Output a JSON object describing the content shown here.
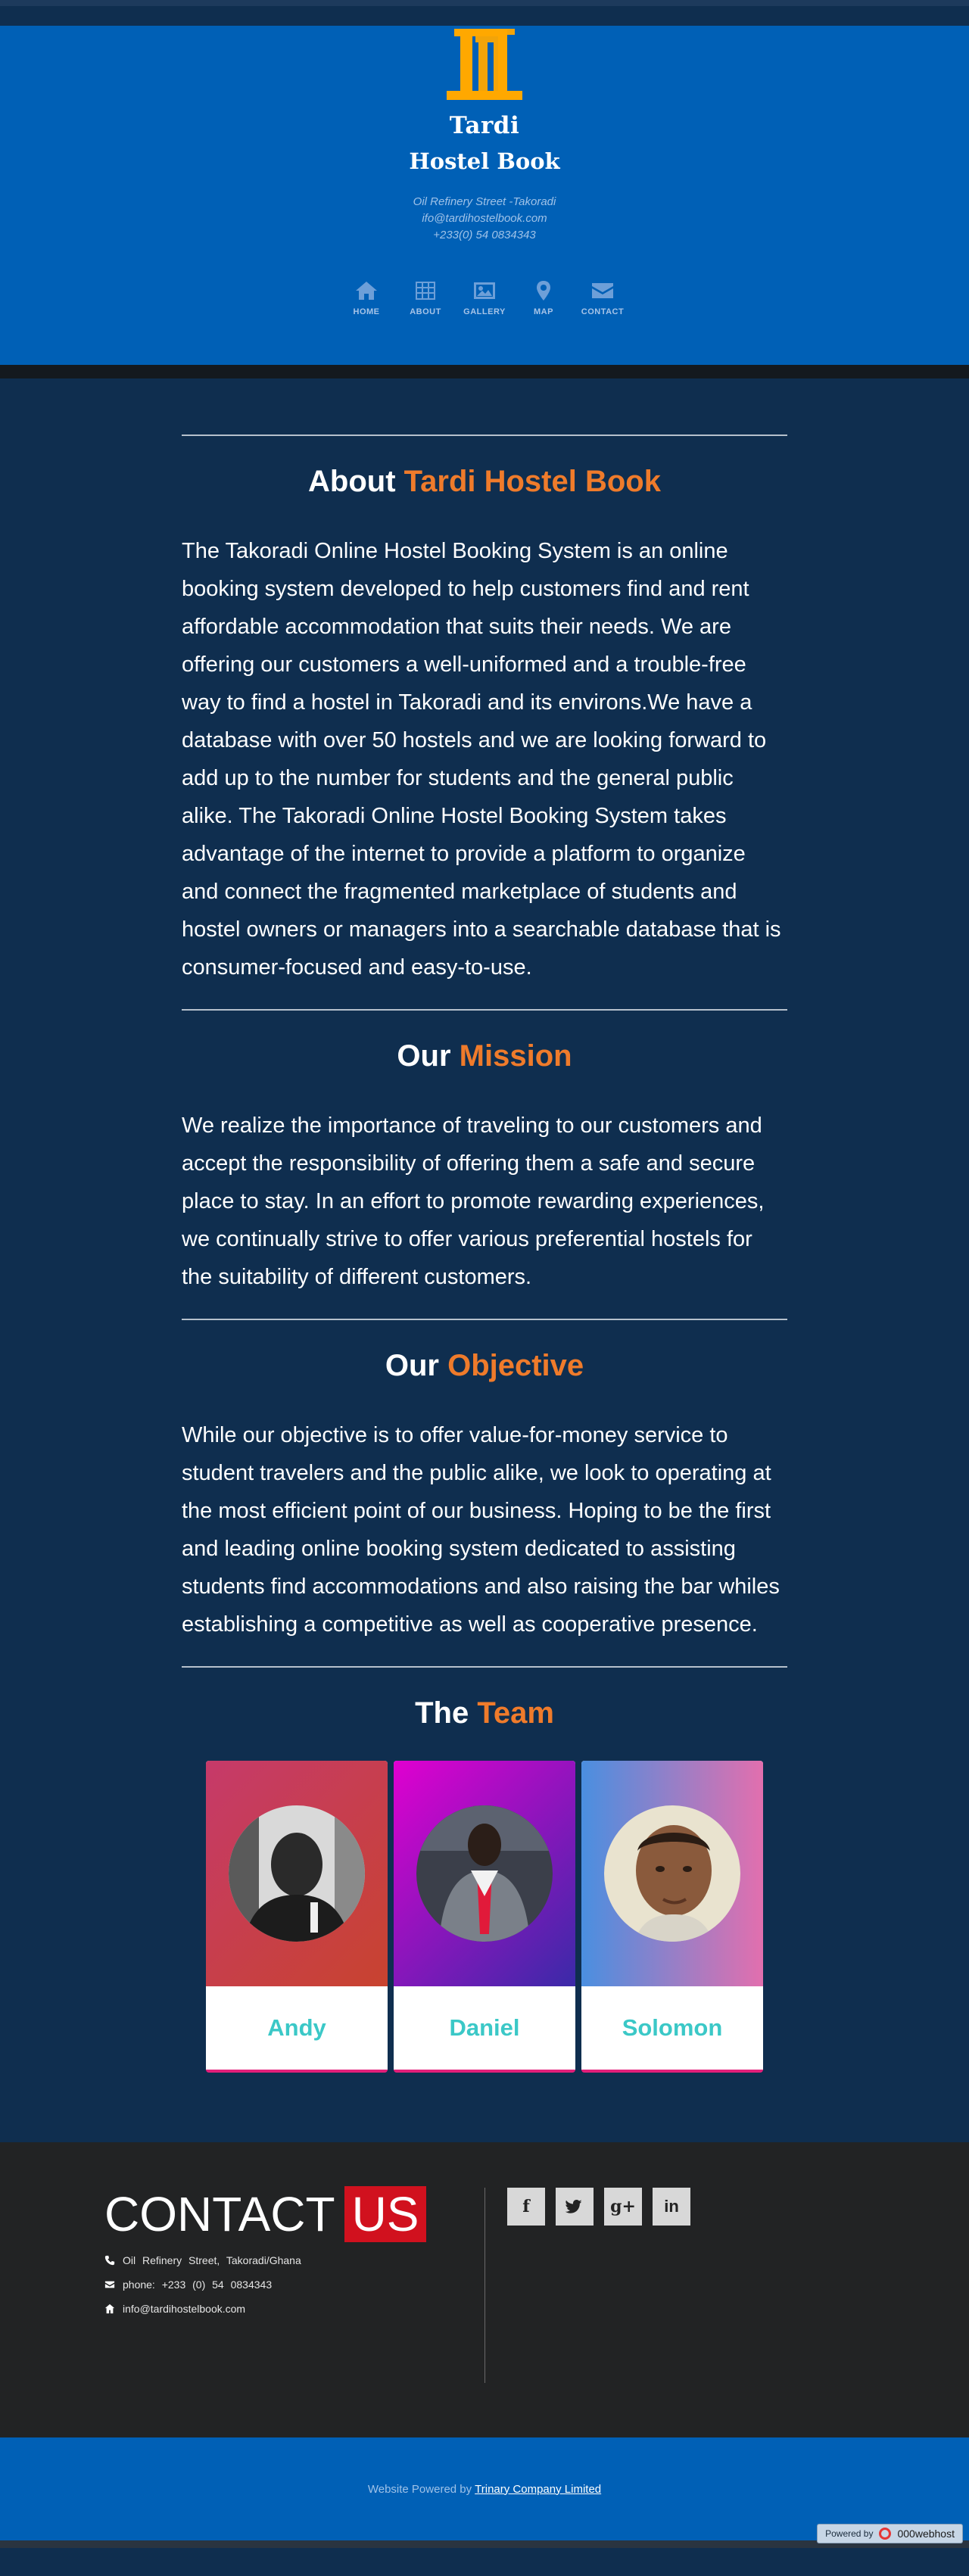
{
  "header": {
    "brand_line1": "Tardi",
    "brand_line2": "Hostel Book",
    "address": "Oil Refinery Street -Takoradi",
    "email": "ifo@tardihostelbook.com",
    "phone": "+233(0) 54 0834343",
    "nav": [
      {
        "label": "HOME",
        "icon": "home-icon"
      },
      {
        "label": "ABOUT",
        "icon": "grid-icon"
      },
      {
        "label": "GALLERY",
        "icon": "image-icon"
      },
      {
        "label": "MAP",
        "icon": "map-pin-icon"
      },
      {
        "label": "CONTACT",
        "icon": "envelope-icon"
      }
    ],
    "colors": {
      "header_bg": "#0060b6",
      "logo": "#ffa800"
    }
  },
  "about": {
    "title_prefix": "About",
    "title_accent": "Tardi Hostel Book",
    "body": "The Takoradi Online Hostel Booking System is an online booking system developed to help customers find and rent affordable accommodation that suits their needs. We are offering our customers a well-uniformed and a trouble-free way to find a hostel in Takoradi and its environs.We have a database with over 50 hostels and we are looking forward to add up to the number for students and the general public alike. The Takoradi Online Hostel Booking System takes advantage of the internet to provide a platform to organize and connect the fragmented marketplace of students and hostel owners or managers into a searchable database that is consumer-focused and easy-to-use."
  },
  "mission": {
    "title_prefix": "Our",
    "title_accent": "Mission",
    "body": "We realize the importance of traveling to our customers and accept the responsibility of offering them a safe and secure place to stay. In an effort to promote rewarding experiences, we continually strive to offer various preferential hostels for the suitability of different customers."
  },
  "objective": {
    "title_prefix": "Our",
    "title_accent": "Objective",
    "body": "While our objective is to offer value-for-money service to student travelers and the public alike, we look to operating at the most efficient point of our business. Hoping to be the first and leading online booking system dedicated to assisting students find accommodations and also raising the bar whiles establishing a competitive as well as cooperative presence."
  },
  "team": {
    "title_prefix": "The",
    "title_accent": "Team",
    "members": [
      {
        "name": "Andy"
      },
      {
        "name": "Daniel"
      },
      {
        "name": "Solomon"
      }
    ]
  },
  "contact": {
    "title": "CONTACT",
    "title_highlight": "US",
    "address": "Oil Refinery Street, Takoradi/Ghana",
    "phone": "phone: +233 (0) 54 0834343",
    "email": "info@tardihostelbook.com",
    "socials": [
      "facebook-icon",
      "twitter-icon",
      "google-plus-icon",
      "linkedin-icon"
    ],
    "social_labels": {
      "google_plus": "g+",
      "linkedin": "in",
      "facebook": "f"
    }
  },
  "footer": {
    "powered_prefix": "Website Powered by",
    "powered_link": "Trinary Company Limited",
    "badge_prefix": "Powered by",
    "badge_name": "000webhost"
  }
}
